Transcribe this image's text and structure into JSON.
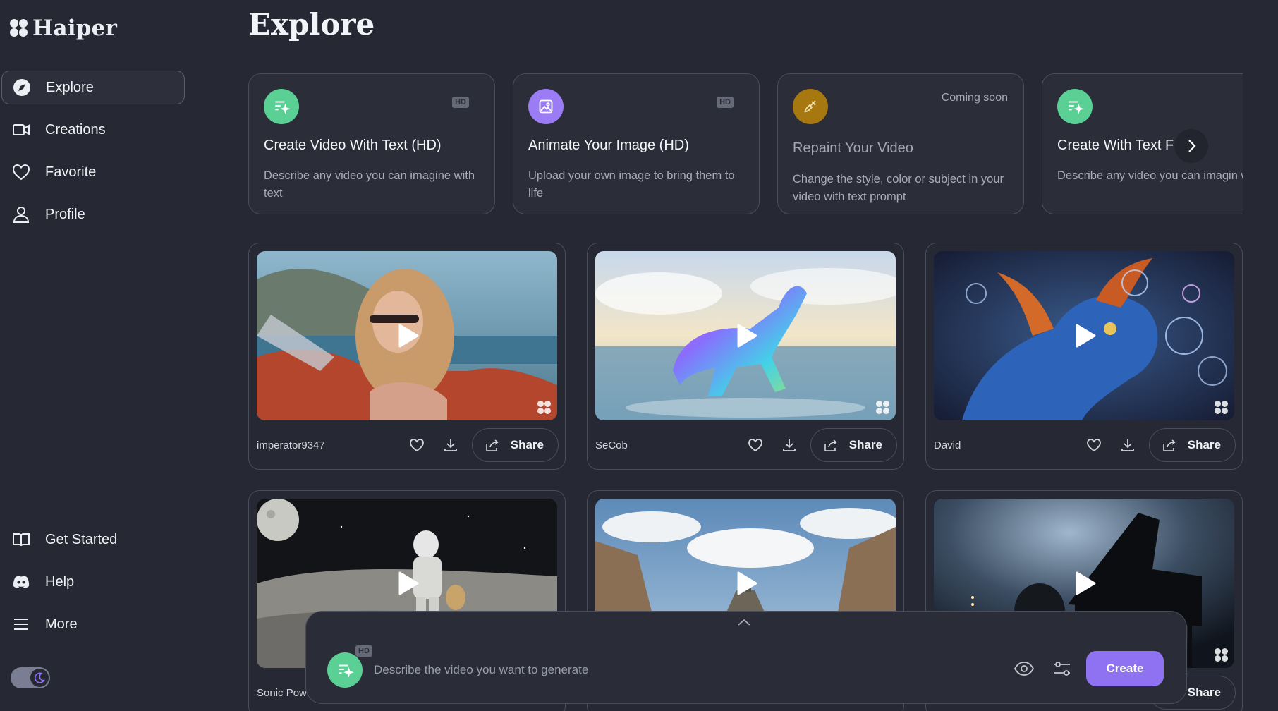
{
  "app": {
    "name": "Haiper"
  },
  "colors": {
    "background": "#262833",
    "accent": "#8f72f2",
    "green": "#5ad095",
    "purple": "#9c7cf4",
    "gold": "#b8860b"
  },
  "sidebar": {
    "items": [
      {
        "label": "Explore",
        "icon": "compass-icon",
        "active": true
      },
      {
        "label": "Creations",
        "icon": "video-camera-icon"
      },
      {
        "label": "Favorite",
        "icon": "heart-icon"
      },
      {
        "label": "Profile",
        "icon": "user-icon"
      }
    ],
    "bottom_items": [
      {
        "label": "Get Started",
        "icon": "book-icon"
      },
      {
        "label": "Help",
        "icon": "discord-icon"
      },
      {
        "label": "More",
        "icon": "menu-icon"
      }
    ],
    "theme_toggle": {
      "icon": "moon-icon",
      "mode": "dark"
    }
  },
  "main": {
    "title": "Explore",
    "features": [
      {
        "title": "Create Video With Text (HD)",
        "description": "Describe any video you can imagine with text",
        "badge": "HD",
        "icon": "text-sparkle-icon"
      },
      {
        "title": "Animate Your Image (HD)",
        "description": "Upload your own image to bring them to life",
        "badge": "HD",
        "icon": "image-icon"
      },
      {
        "title": "Repaint Your Video",
        "description": "Change the style, color or subject in your video with text prompt",
        "status": "Coming soon",
        "icon": "brush-icon"
      },
      {
        "title": "Create With Text F",
        "title_tail": "t",
        "description": "Describe any video you can imagin with text",
        "icon": "text-sparkle-icon"
      }
    ],
    "share_label": "Share",
    "videos": [
      {
        "user": "imperator9347",
        "scene": "woman-in-convertible"
      },
      {
        "user": "SeCob",
        "scene": "rainbow-horse-on-beach"
      },
      {
        "user": "David",
        "scene": "blue-dragon-with-bubbles"
      },
      {
        "user": "Sonic Pow",
        "scene": "astronaut-on-moon"
      },
      {
        "user": "",
        "scene": "pyramid-in-clouds"
      },
      {
        "user": "",
        "scene": "gorilla-at-piano"
      }
    ]
  },
  "prompt": {
    "badge": "HD",
    "placeholder": "Describe the video you want to generate",
    "create_label": "Create"
  }
}
